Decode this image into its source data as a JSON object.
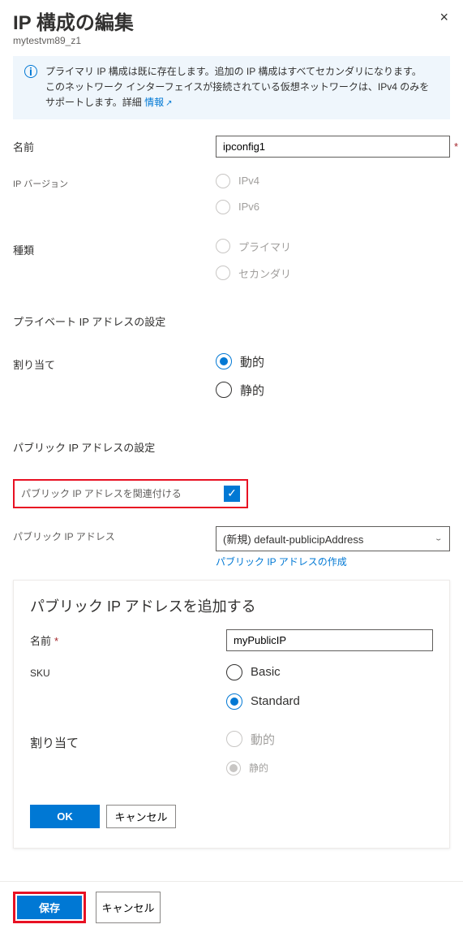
{
  "header": {
    "title": "IP 構成の編集",
    "subtitle": "mytestvm89_z1",
    "close_label": "×"
  },
  "info": {
    "text1": "プライマリ IP 構成は既に存在します。追加の IP 構成はすべてセカンダリになります。",
    "text2": "このネットワーク インターフェイスが接続されている仮想ネットワークは、IPv4 のみをサポートします。詳細",
    "link": "情報"
  },
  "fields": {
    "name_label": "名前",
    "name_value": "ipconfig1",
    "ipver_label": "IP バージョン",
    "ipver_options": {
      "v4": "IPv4",
      "v6": "IPv6"
    },
    "type_label": "種類",
    "type_options": {
      "primary": "プライマリ",
      "secondary": "セカンダリ"
    }
  },
  "private": {
    "heading": "プライベート IP アドレスの設定",
    "alloc_label": "割り当て",
    "alloc_options": {
      "dynamic": "動的",
      "static": "静的"
    }
  },
  "public": {
    "heading": "パブリック IP アドレスの設定",
    "associate_label": "パブリック IP アドレスを関連付ける",
    "address_label": "パブリック IP アドレス",
    "address_value": "(新規) default-publicipAddress",
    "create_link": "パブリック IP アドレスの作成"
  },
  "callout": {
    "title": "パブリック IP アドレスを追加する",
    "name_label": "名前",
    "name_value": "myPublicIP",
    "sku_label": "SKU",
    "sku_options": {
      "basic": "Basic",
      "standard": "Standard"
    },
    "alloc_label": "割り当て",
    "alloc_options": {
      "dynamic": "動的",
      "static": "静的"
    },
    "ok": "OK",
    "cancel": "キャンセル"
  },
  "footer": {
    "save": "保存",
    "cancel": "キャンセル"
  }
}
